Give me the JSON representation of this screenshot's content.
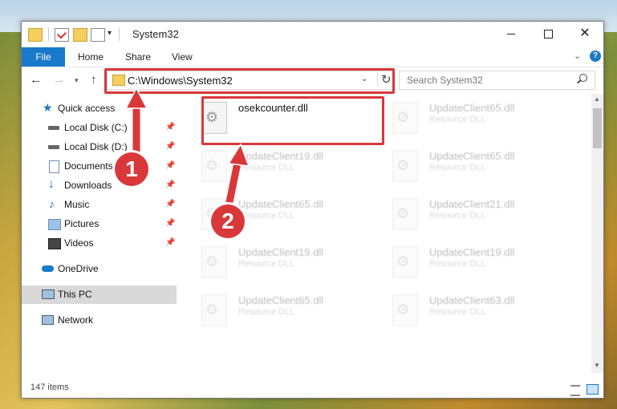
{
  "window": {
    "title": "System32",
    "controls": {
      "minimize_icon": "minimize-icon",
      "maximize_icon": "maximize-icon",
      "close_label": "✕"
    }
  },
  "ribbon": {
    "tabs": [
      "File",
      "Home",
      "Share",
      "View"
    ],
    "help": "?"
  },
  "navigation": {
    "address": "C:\\Windows\\System32",
    "search_placeholder": "Search System32"
  },
  "sidebar": {
    "items": [
      {
        "label": "Quick access",
        "icon": "star-icon",
        "pinned": false
      },
      {
        "label": "Local Disk (C:)",
        "icon": "drive-icon",
        "pinned": true
      },
      {
        "label": "Local Disk (D:)",
        "icon": "drive-icon",
        "pinned": true
      },
      {
        "label": "Documents",
        "icon": "documents-icon",
        "pinned": true
      },
      {
        "label": "Downloads",
        "icon": "download-icon",
        "pinned": true
      },
      {
        "label": "Music",
        "icon": "music-icon",
        "pinned": true
      },
      {
        "label": "Pictures",
        "icon": "pictures-icon",
        "pinned": true
      },
      {
        "label": "Videos",
        "icon": "videos-icon",
        "pinned": true
      },
      {
        "label": "OneDrive",
        "icon": "cloud-icon",
        "pinned": false
      },
      {
        "label": "This PC",
        "icon": "computer-icon",
        "pinned": false
      },
      {
        "label": "Network",
        "icon": "network-icon",
        "pinned": false
      }
    ]
  },
  "files": [
    {
      "name": "osekcounter.dll",
      "type": ""
    },
    {
      "name": "UpdateClient65.dll",
      "type": "Resource DLL"
    },
    {
      "name": "UpdateClient19.dll",
      "type": "Resource DLL"
    },
    {
      "name": "UpdateClient65.dll",
      "type": "Resource DLL"
    },
    {
      "name": "UpdateClient65.dll",
      "type": "Resource DLL"
    },
    {
      "name": "UpdateClient21.dll",
      "type": "Resource DLL"
    },
    {
      "name": "UpdateClient19.dll",
      "type": "Resource DLL"
    },
    {
      "name": "UpdateClient19.dll",
      "type": "Resource DLL"
    },
    {
      "name": "UpdateClient65.dll",
      "type": "Resource DLL"
    },
    {
      "name": "UpdateClient63.dll",
      "type": "Resource DLL"
    }
  ],
  "status": {
    "item_count": "147 items"
  },
  "annotations": {
    "step1": "1",
    "step2": "2",
    "color": "#d9383a"
  }
}
